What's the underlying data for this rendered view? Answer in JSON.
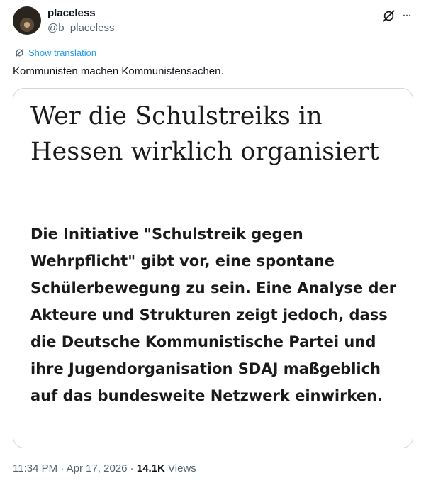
{
  "author": {
    "name": "placeless",
    "handle": "@b_placeless"
  },
  "header_icons": {
    "grok": "grok-icon",
    "more": "more-icon",
    "more_glyph": "···"
  },
  "translation": {
    "label": "Show translation",
    "icon": "translate-icon"
  },
  "tweet": {
    "text": "Kommunisten machen Kommunistensachen."
  },
  "media": {
    "headline": "Wer die Schulstreiks in Hessen wirklich organisiert",
    "summary": "Die Initiative \"Schulstreik gegen Wehrpflicht\" gibt vor, eine spontane Schülerbewegung zu sein. Eine Analyse der Akteure und Strukturen zeigt jedoch, dass die Deutsche Kommunistische Partei und ihre Jugendorganisation SDAJ maßgeblich auf das bundesweite Netzwerk einwirken."
  },
  "meta": {
    "time": "11:34 PM",
    "separator": " · ",
    "date": "Apr 17, 2026",
    "views_count": "14.1K",
    "views_label": " Views"
  },
  "colors": {
    "text": "#0f1419",
    "secondary": "#536471",
    "accent": "#1d9bf0",
    "border": "#cfd9de"
  }
}
